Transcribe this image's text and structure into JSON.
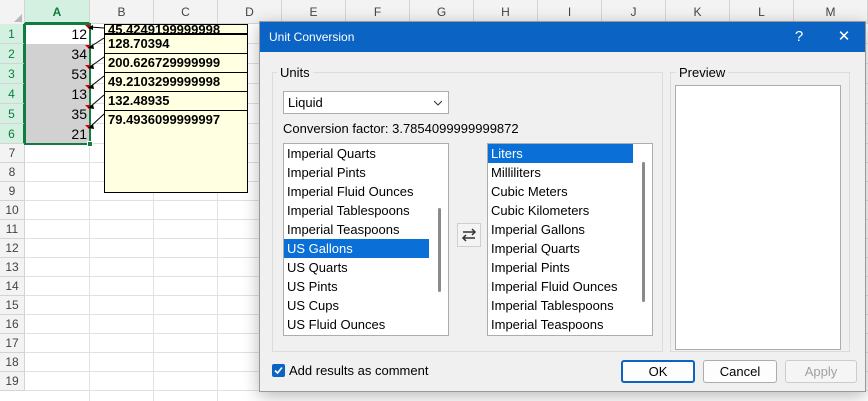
{
  "sheet": {
    "columns": [
      "A",
      "B",
      "C",
      "D",
      "E",
      "F",
      "G",
      "H",
      "I",
      "J",
      "K",
      "L",
      "M"
    ],
    "rows": [
      "1",
      "2",
      "3",
      "4",
      "5",
      "6",
      "7",
      "8",
      "9",
      "10",
      "11",
      "12",
      "13",
      "14",
      "15",
      "16",
      "17",
      "18",
      "19"
    ],
    "a_values": [
      "12",
      "34",
      "53",
      "13",
      "35",
      "21"
    ],
    "comments": [
      "45.4249199999998",
      "128.70394",
      "200.626729999999",
      "49.2103299999998",
      "132.48935",
      "79.4936099999997"
    ]
  },
  "dialog": {
    "title": "Unit Conversion",
    "help": "?",
    "close": "✕",
    "units_label": "Units",
    "unit_category": "Liquid",
    "conversion_factor": "Conversion factor: 3.7854099999999872",
    "from_units": [
      "Imperial Quarts",
      "Imperial Pints",
      "Imperial Fluid Ounces",
      "Imperial Tablespoons",
      "Imperial Teaspoons",
      "US Gallons",
      "US Quarts",
      "US Pints",
      "US Cups",
      "US Fluid Ounces"
    ],
    "from_selected": "US Gallons",
    "to_units": [
      "Liters",
      "Milliliters",
      "Cubic Meters",
      "Cubic Kilometers",
      "Imperial Gallons",
      "Imperial Quarts",
      "Imperial Pints",
      "Imperial Fluid Ounces",
      "Imperial Tablespoons",
      "Imperial Teaspoons"
    ],
    "to_selected": "Liters",
    "preview_label": "Preview",
    "add_comment_label": "Add results as comment",
    "add_comment_checked": true,
    "ok_label": "OK",
    "cancel_label": "Cancel",
    "apply_label": "Apply"
  },
  "colors": {
    "titlebar": "#0b63c4",
    "selection": "#0a6fd6",
    "excel_green": "#107c41",
    "comment_bg": "#ffffe1"
  },
  "icons": {
    "swap": "swap-arrows-icon",
    "dropdown": "chevron-down-icon",
    "checkbox": "checkmark-icon"
  }
}
